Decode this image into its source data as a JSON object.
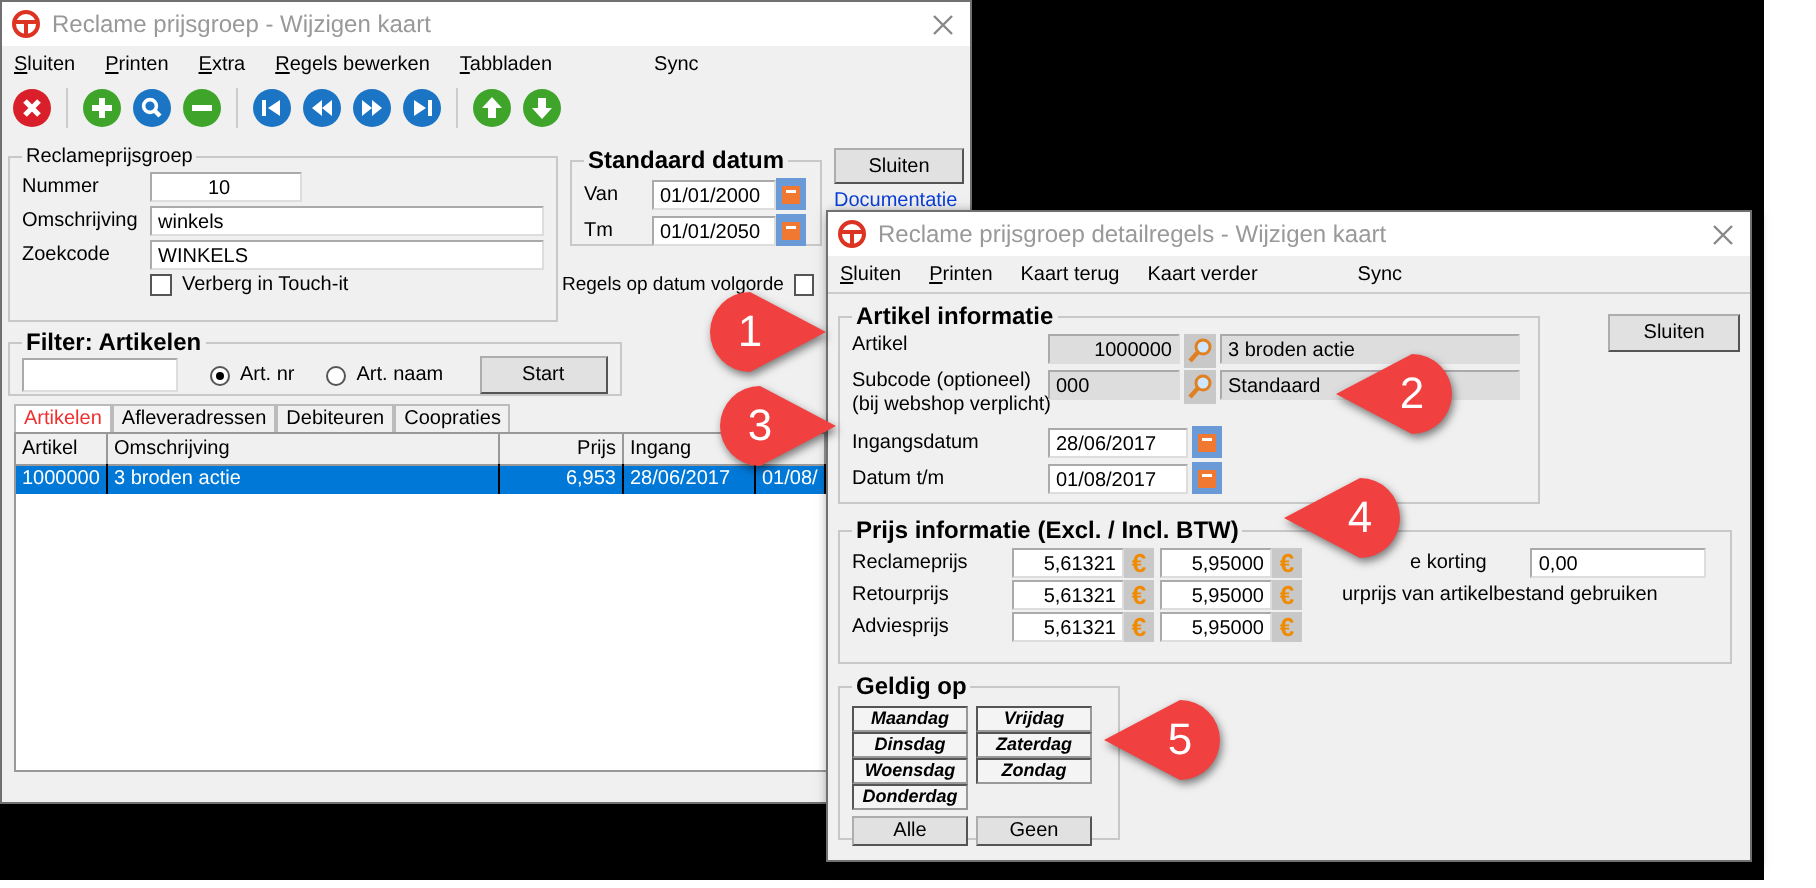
{
  "main_window": {
    "title": "Reclame prijsgroep - Wijzigen kaart",
    "menu": [
      {
        "label": "Sluiten",
        "mnemonic": true
      },
      {
        "label": "Printen",
        "mnemonic": true
      },
      {
        "label": "Extra",
        "mnemonic": true
      },
      {
        "label": "Regels bewerken",
        "mnemonic": true
      },
      {
        "label": "Tabbladen",
        "mnemonic": true
      },
      {
        "label": "Sync",
        "mnemonic": false
      }
    ],
    "group": {
      "title": "Reclameprijsgroep",
      "fields": [
        {
          "label": "Nummer",
          "value": "10"
        },
        {
          "label": "Omschrijving",
          "value": "winkels"
        },
        {
          "label": "Zoekcode",
          "value": "WINKELS"
        }
      ],
      "checkbox": {
        "label": "Verberg in Touch-it",
        "checked": false
      }
    },
    "date_group": {
      "title": "Standaard datum",
      "fields": [
        {
          "label": "Van",
          "value": "01/01/2000"
        },
        {
          "label": "Tm",
          "value": "01/01/2050"
        }
      ]
    },
    "order_checkbox": {
      "label": "Regels op datum volgorde",
      "checked": false
    },
    "close_button": "Sluiten",
    "link": "Documentatie",
    "filter": {
      "title": "Filter: Artikelen",
      "options": [
        {
          "label": "Art. nr",
          "selected": true
        },
        {
          "label": "Art. naam",
          "selected": false
        }
      ],
      "button": "Start"
    },
    "tabs": [
      {
        "label": "Artikelen",
        "selected": true
      },
      {
        "label": "Afleveradressen",
        "selected": false
      },
      {
        "label": "Debiteuren",
        "selected": false
      },
      {
        "label": "Coopraties",
        "selected": false
      }
    ],
    "table": {
      "columns": [
        "Artikel",
        "Omschrijving",
        "Prijs",
        "Ingang"
      ],
      "rows": [
        {
          "cells": [
            "1000000",
            "3 broden actie",
            "6,953",
            "28/06/2017",
            "01/08/"
          ],
          "selected": true
        }
      ]
    }
  },
  "detail_window": {
    "title": "Reclame prijsgroep detailregels - Wijzigen kaart",
    "menu": [
      {
        "label": "Sluiten",
        "mnemonic": true
      },
      {
        "label": "Printen",
        "mnemonic": true
      },
      {
        "label": "Kaart terug",
        "mnemonic": false
      },
      {
        "label": "Kaart verder",
        "mnemonic": false
      },
      {
        "label": "Sync",
        "mnemonic": false
      }
    ],
    "article_group": {
      "title": "Artikel informatie",
      "rows": [
        {
          "label": "Artikel",
          "code": "1000000",
          "name": "3 broden actie"
        },
        {
          "label": "Subcode (optioneel)",
          "note": "(bij webshop verplicht)",
          "code": "000",
          "name": "Standaard"
        }
      ],
      "dates": [
        {
          "label": "Ingangsdatum",
          "value": "28/06/2017"
        },
        {
          "label": "Datum t/m",
          "value": "01/08/2017"
        }
      ]
    },
    "close_button": "Sluiten",
    "price_group": {
      "title": "Prijs informatie (Excl. / Incl. BTW)",
      "rows": [
        {
          "label": "Reclameprijs",
          "excl": "5,61321",
          "excl_unit": "€",
          "incl": "5,95000",
          "incl_unit": "€"
        },
        {
          "label": "Retourprijs",
          "excl": "5,61321",
          "excl_unit": "€",
          "incl": "5,95000",
          "incl_unit": "€"
        },
        {
          "label": "Adviesprijs",
          "excl": "5,61321",
          "excl_unit": "€",
          "incl": "5,95000",
          "incl_unit": "€"
        }
      ],
      "discount_label": "e korting",
      "discount_value": "0,00",
      "use_label": "urprijs van artikelbestand gebruiken"
    },
    "valid_group": {
      "title": "Geldig op",
      "days": [
        "Maandag",
        "Dinsdag",
        "Woensdag",
        "Donderdag",
        "Vrijdag",
        "Zaterdag",
        "Zondag"
      ],
      "buttons": [
        "Alle",
        "Geen"
      ]
    }
  },
  "callouts": [
    {
      "number": "1",
      "kind": "rightward"
    },
    {
      "number": "2",
      "kind": "leftward"
    },
    {
      "number": "3",
      "kind": "rightward"
    },
    {
      "number": "4",
      "kind": "leftward"
    },
    {
      "number": "5",
      "kind": "leftward"
    }
  ]
}
